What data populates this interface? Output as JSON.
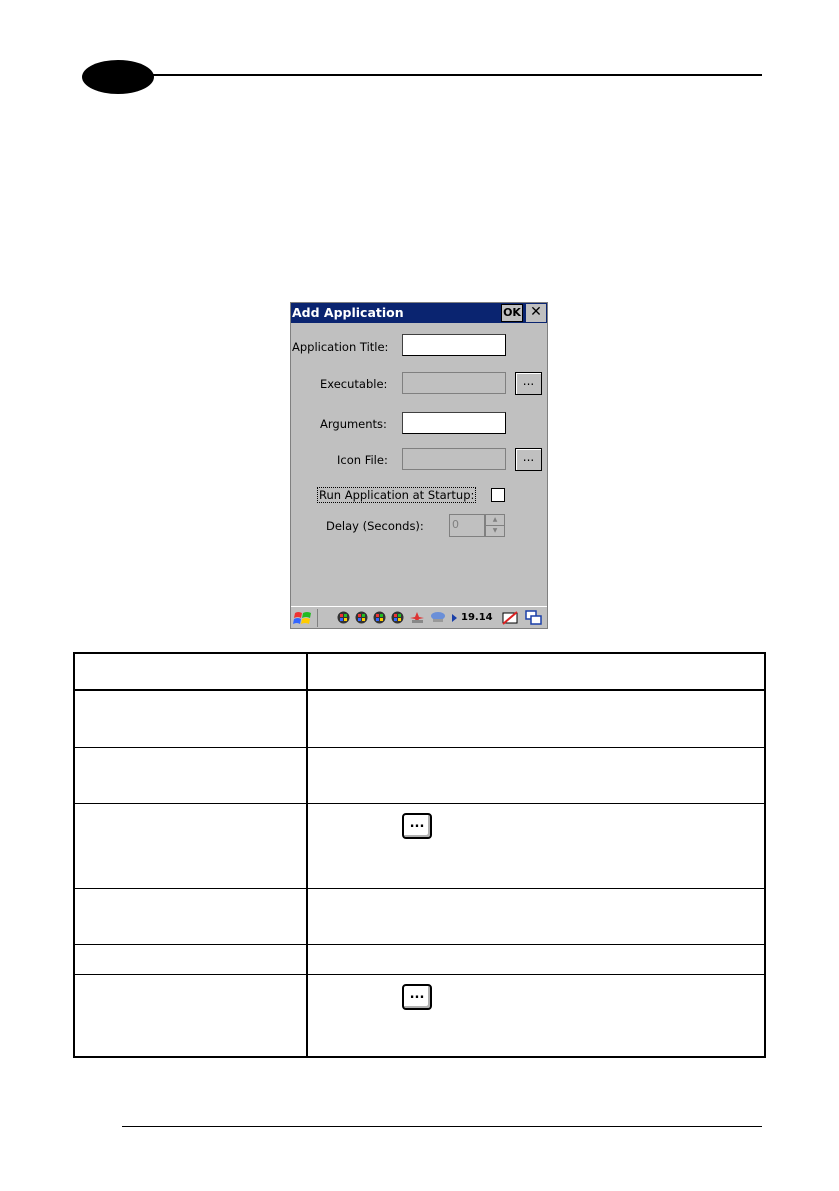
{
  "dialog": {
    "title": "Add Application",
    "ok_label": "OK",
    "close_label": "✕",
    "fields": {
      "application_title": {
        "label": "Application Title:",
        "value": ""
      },
      "executable": {
        "label": "Executable:",
        "value": "",
        "browse_label": "..."
      },
      "arguments": {
        "label": "Arguments:",
        "value": ""
      },
      "icon_file": {
        "label": "Icon File:",
        "value": "",
        "browse_label": "..."
      },
      "run_at_startup": {
        "label": "Run Application at Startup:",
        "checked": false
      },
      "delay": {
        "label": "Delay (Seconds):",
        "value": "0"
      }
    }
  },
  "taskbar": {
    "time": "19.14",
    "icons": [
      "windows-start-icon",
      "app-icon",
      "app-icon",
      "app-icon",
      "app-icon",
      "network-icon",
      "connection-icon",
      "keyboard-icon",
      "desktop-icon"
    ]
  },
  "table": {
    "inline_button_label": "..."
  },
  "colors": {
    "titlebar": "#0a2470",
    "dialog_bg": "#c0c0c0"
  }
}
